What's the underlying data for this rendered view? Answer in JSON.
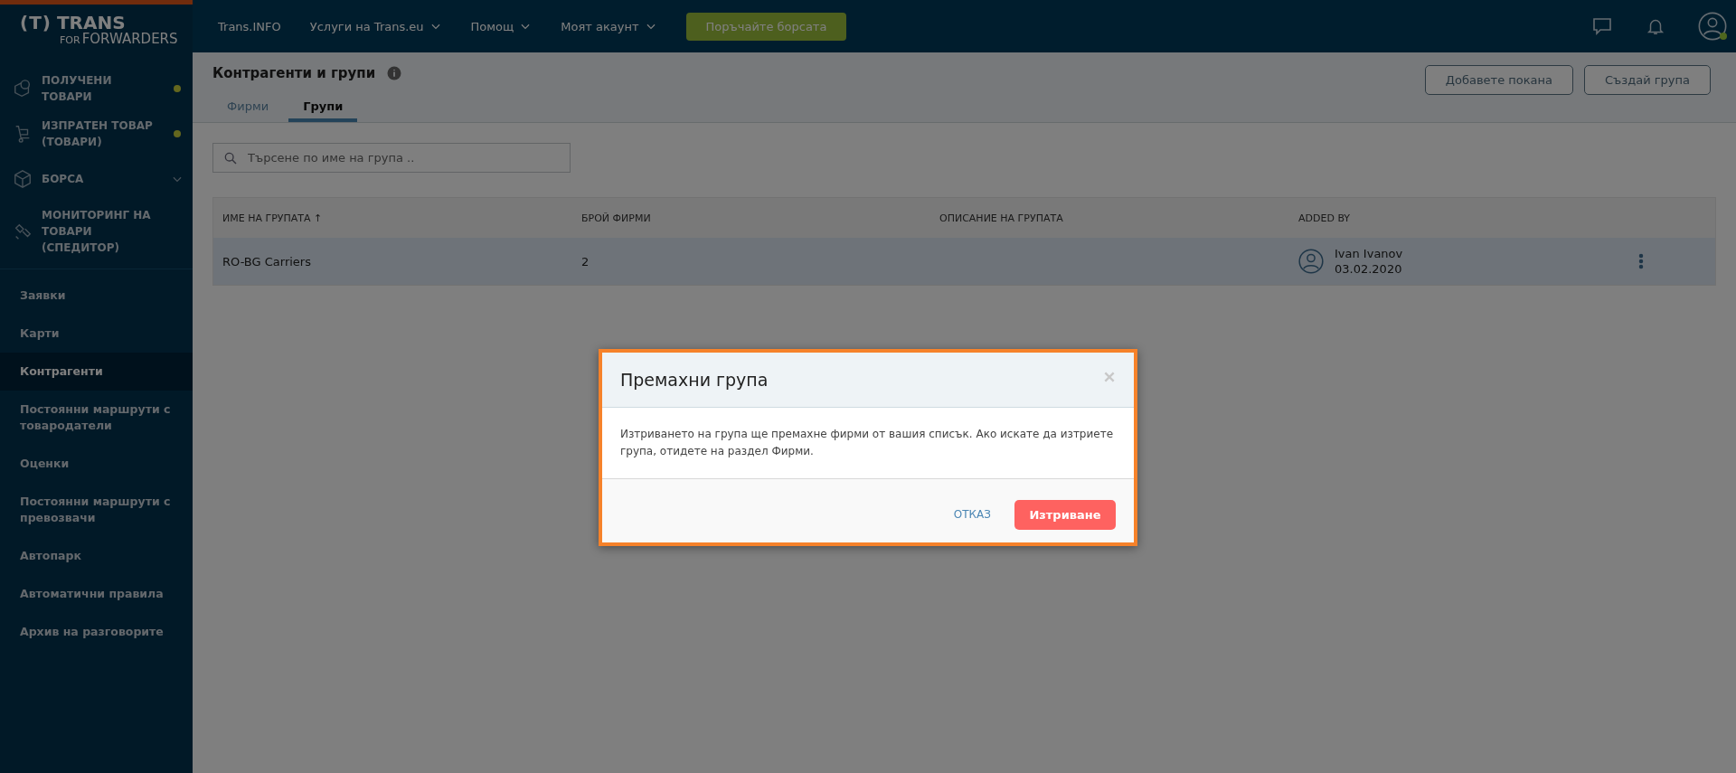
{
  "logo": {
    "mark": "(T)",
    "brand": "TRANS",
    "prefix": "FOR",
    "product": "FORWARDERS"
  },
  "topnav": {
    "items": [
      {
        "label": "Trans.INFO",
        "dropdown": false
      },
      {
        "label": "Услуги на Trans.eu",
        "dropdown": true
      },
      {
        "label": "Помощ",
        "dropdown": true
      },
      {
        "label": "Моят акаунт",
        "dropdown": true
      }
    ],
    "cta": "Поръчайте борсата",
    "user_online": true
  },
  "sidebar": {
    "modules": [
      {
        "label": "ПОЛУЧЕНИ ТОВАРИ",
        "dot": true,
        "expandable": false
      },
      {
        "label": "ИЗПРАТЕН ТОВАР (ТОВАРИ)",
        "dot": true,
        "expandable": false
      },
      {
        "label": "БОРСА",
        "dot": false,
        "expandable": true
      },
      {
        "label": "МОНИТОРИНГ НА ТОВАРИ (СПЕДИТОР)",
        "dot": false,
        "expandable": false
      }
    ],
    "items": [
      {
        "label": "Заявки",
        "selected": false
      },
      {
        "label": "Карти",
        "selected": false
      },
      {
        "label": "Контрагенти",
        "selected": true
      },
      {
        "label": "Постоянни маршрути с товародатели",
        "selected": false
      },
      {
        "label": "Оценки",
        "selected": false
      },
      {
        "label": "Постоянни маршрути с превозвачи",
        "selected": false
      },
      {
        "label": "Автопарк",
        "selected": false
      },
      {
        "label": "Автоматични правила",
        "selected": false
      },
      {
        "label": "Архив на разговорите",
        "selected": false
      }
    ]
  },
  "page": {
    "title": "Контрагенти и групи",
    "actions": [
      "Добавете покана",
      "Създай група"
    ],
    "tabs": [
      {
        "label": "Фирми",
        "selected": false
      },
      {
        "label": "Групи",
        "selected": true
      }
    ],
    "search": {
      "placeholder": "Търсене по име на група .."
    }
  },
  "table": {
    "columns": [
      "ИМЕ НА ГРУПАТА ↑",
      "БРОЙ ФИРМИ",
      "ОПИСАНИЕ НА ГРУПАТА",
      "ADDED BY"
    ],
    "rows": [
      {
        "name": "RO-BG Carriers",
        "count": "2",
        "added_by": "Ivan Ivanov",
        "date": "03.02.2020",
        "selected": true
      }
    ]
  },
  "dialog": {
    "title": "Премахни група",
    "message": "Изтриването на група ще премахне фирми от вашия списък. Ако искате да изтриете група, отидете на раздел Фирми.",
    "cancel": "ОТКАЗ",
    "confirm": "Изтриване"
  }
}
